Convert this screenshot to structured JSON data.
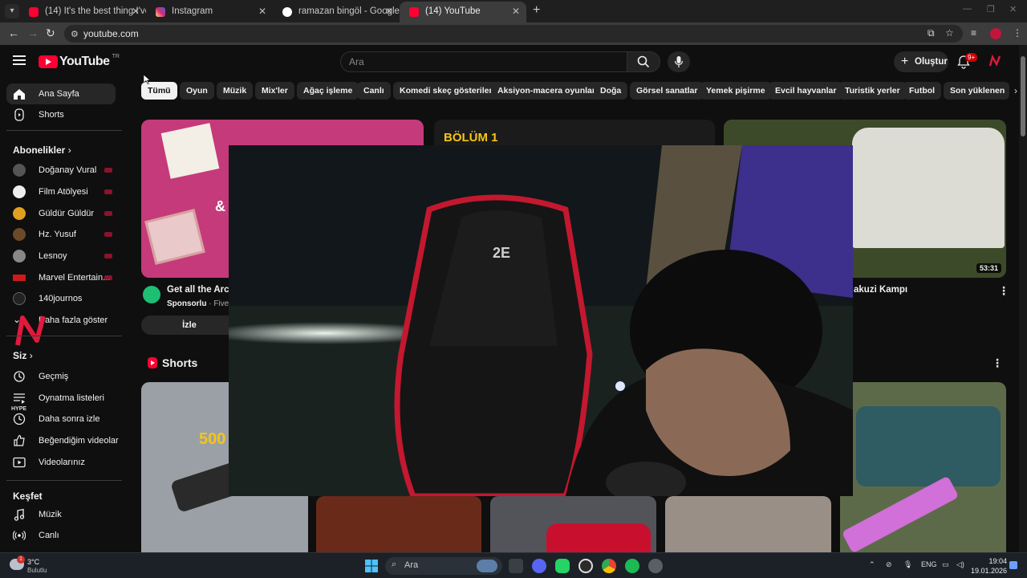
{
  "browser": {
    "tabs": [
      {
        "title": "(14) It's the best thing I've seen",
        "favicon_color": "#ff0033",
        "active": false
      },
      {
        "title": "Instagram",
        "favicon_color": "#d62976",
        "active": false
      },
      {
        "title": "ramazan bingöl - Google'da Ar",
        "favicon_color": "#ffffff",
        "active": false
      },
      {
        "title": "(14) YouTube",
        "favicon_color": "#ff0033",
        "active": true
      }
    ],
    "url": "youtube.com"
  },
  "header": {
    "logo_text": "YouTube",
    "country_code": "TR",
    "search_placeholder": "Ara",
    "create_label": "Oluştur",
    "notifications_badge": "9+"
  },
  "sidebar": {
    "main": [
      {
        "label": "Ana Sayfa",
        "icon": "home-icon",
        "active": true
      },
      {
        "label": "Shorts",
        "icon": "shorts-icon"
      }
    ],
    "subscriptions_title": "Abonelikler",
    "subscriptions": [
      {
        "label": "Doğanay Vural",
        "live": true,
        "color": "#555555"
      },
      {
        "label": "Film Atölyesi",
        "live": true,
        "color": "#eeeeee"
      },
      {
        "label": "Güldür Güldür",
        "live": true,
        "color": "#e0a020"
      },
      {
        "label": "Hz. Yusuf",
        "live": true,
        "color": "#6b4a2a"
      },
      {
        "label": "Lesnoy",
        "live": true,
        "color": "#888888"
      },
      {
        "label": "Marvel Entertain...",
        "live": true,
        "color": "#cc1a1a"
      },
      {
        "label": "140journos",
        "live": false,
        "color": "#222222"
      },
      {
        "label": "Daha fazla göster",
        "live": false,
        "color": ""
      }
    ],
    "you_title": "Siz",
    "you": [
      {
        "label": "Geçmiş",
        "icon": "history-icon"
      },
      {
        "label": "Oynatma listeleri",
        "icon": "playlist-icon"
      },
      {
        "label": "Daha sonra izle",
        "icon": "watch-later-icon"
      },
      {
        "label": "Beğendiğim videolar",
        "icon": "like-icon"
      },
      {
        "label": "Videolarınız",
        "icon": "your-videos-icon"
      }
    ],
    "explore_title": "Keşfet",
    "explore": [
      {
        "label": "Müzik",
        "icon": "music-icon"
      },
      {
        "label": "Canlı",
        "icon": "live-icon"
      }
    ]
  },
  "chips": [
    "Tümü",
    "Oyun",
    "Müzik",
    "Mix'ler",
    "Ağaç işleme",
    "Canlı",
    "Komedi skeç gösterileri",
    "Aksiyon-macera oyunları",
    "Doğa",
    "Görsel sanatlar",
    "Yemek pişirme",
    "Evcil hayvanlar",
    "Turistik yerler",
    "Futbol",
    "Son yüklenen"
  ],
  "videos": {
    "ad": {
      "title": "Get all the Archi",
      "sponsor": "Sponsorlu",
      "channel": "Fiverr",
      "cta": "İzle",
      "thumb_text": "&"
    },
    "middle": {
      "thumb_text": "BÖLÜM 1"
    },
    "right": {
      "title": "akuzi Kampı",
      "duration": "53:31"
    }
  },
  "shorts": {
    "title": "Shorts",
    "first_thumb_text": "500"
  },
  "taskbar": {
    "weather_temp": "3°C",
    "weather_desc": "Bulutlu",
    "weather_badge": "1",
    "search_label": "Ara",
    "lang": "ENG",
    "time": "19:04",
    "date": "19.01.2026"
  },
  "overlay": {
    "stream_logo_text": "HYPE"
  },
  "colors": {
    "accent": "#ff0033",
    "background": "#0f0f0f",
    "chip": "#272727"
  }
}
